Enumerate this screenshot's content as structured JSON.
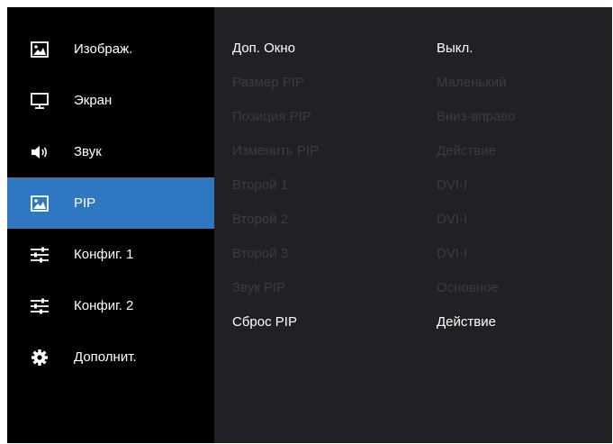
{
  "sidebar": {
    "items": [
      {
        "label": "Изображ.",
        "icon": "picture-icon",
        "active": false
      },
      {
        "label": "Экран",
        "icon": "monitor-icon",
        "active": false
      },
      {
        "label": "Звук",
        "icon": "speaker-icon",
        "active": false
      },
      {
        "label": "PIP",
        "icon": "picture-icon",
        "active": true
      },
      {
        "label": "Конфиг. 1",
        "icon": "sliders-icon",
        "active": false
      },
      {
        "label": "Конфиг. 2",
        "icon": "sliders-icon",
        "active": false
      },
      {
        "label": "Дополнит.",
        "icon": "gear-icon",
        "active": false
      }
    ]
  },
  "settings": {
    "rows": [
      {
        "label": "Доп. Окно",
        "value": "Выкл.",
        "enabled": true
      },
      {
        "label": "Размер PIP",
        "value": "Маленький",
        "enabled": false
      },
      {
        "label": "Позиция PIP",
        "value": "Вниз-вправо",
        "enabled": false
      },
      {
        "label": "Изменить PIP",
        "value": "Действие",
        "enabled": false
      },
      {
        "label": "Второй 1",
        "value": "DVI-I",
        "enabled": false
      },
      {
        "label": "Второй 2",
        "value": "DVI-I",
        "enabled": false
      },
      {
        "label": "Второй 3",
        "value": "DVI-I",
        "enabled": false
      },
      {
        "label": "Звук PIP",
        "value": "Основное",
        "enabled": false
      },
      {
        "label": "Сброс PIP",
        "value": "Действие",
        "enabled": true
      }
    ]
  },
  "colors": {
    "sidebar_bg": "#000000",
    "panel_bg": "#1f2124",
    "active": "#2f78c1",
    "enabled_text": "#ffffff",
    "disabled_text": "#3b3e42"
  }
}
